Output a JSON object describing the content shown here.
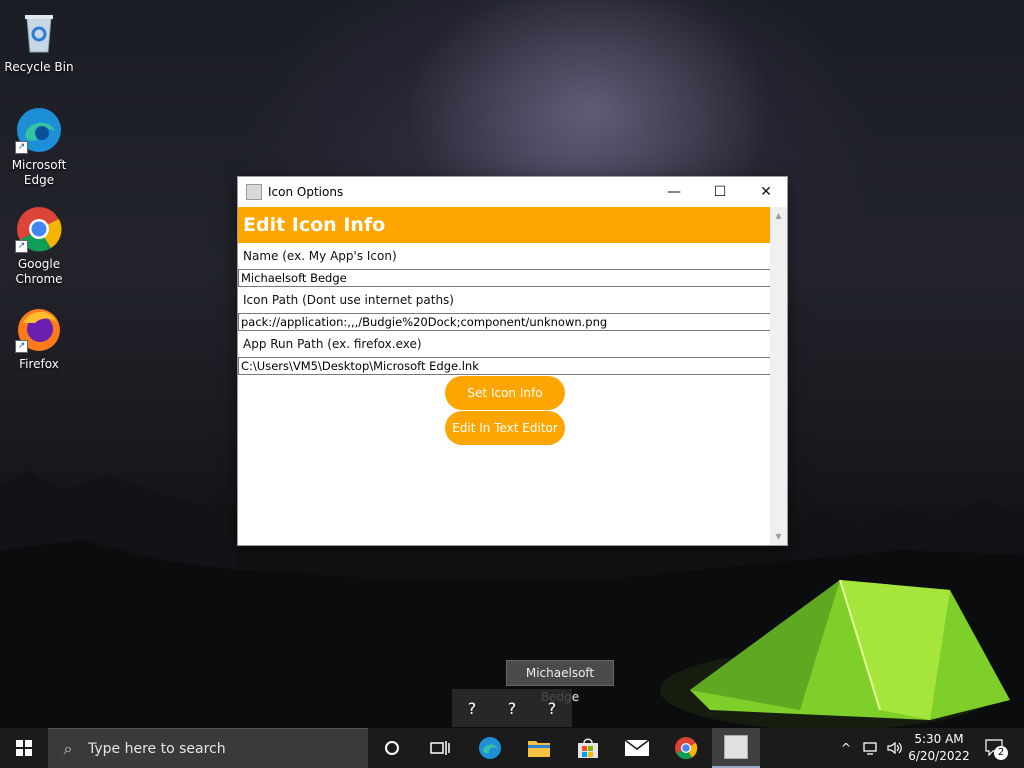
{
  "desktop": {
    "icons": [
      {
        "label_line1": "Recycle Bin",
        "label_line2": ""
      },
      {
        "label_line1": "Microsoft",
        "label_line2": "Edge"
      },
      {
        "label_line1": "Google",
        "label_line2": "Chrome"
      },
      {
        "label_line1": "Firefox",
        "label_line2": ""
      }
    ]
  },
  "window": {
    "title": "Icon Options",
    "minimize_glyph": "—",
    "maximize_glyph": "☐",
    "close_glyph": "✕",
    "header": "Edit Icon Info",
    "fields": [
      {
        "label": "Name (ex. My App's Icon)",
        "value": "Michaelsoft Bedge"
      },
      {
        "label": "Icon Path (Dont use internet paths)",
        "value": "pack://application:,,,/Budgie%20Dock;component/unknown.png"
      },
      {
        "label": "App Run Path (ex. firefox.exe)",
        "value": "C:\\Users\\VM5\\Desktop\\Microsoft Edge.lnk"
      }
    ],
    "set_button": "Set Icon Info",
    "edit_button": "Edit In Text Editor",
    "accent_color": "#ffa500"
  },
  "dock": {
    "tooltip": "Michaelsoft Bedge",
    "items": [
      "?",
      "?",
      "?"
    ]
  },
  "taskbar": {
    "search_placeholder": "Type here to search",
    "time": "5:30 AM",
    "date": "6/20/2022",
    "notification_count": "2"
  }
}
